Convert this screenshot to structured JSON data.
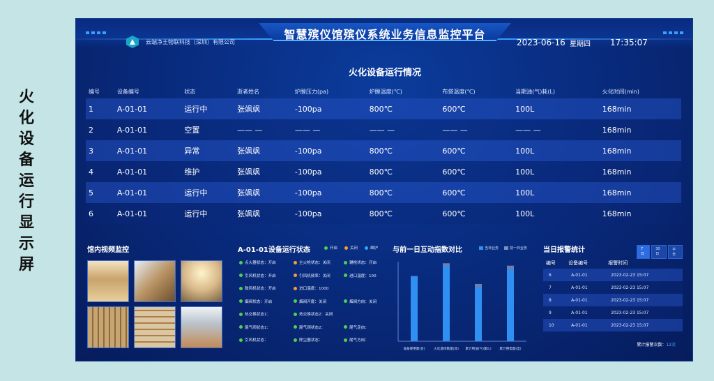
{
  "side_title": [
    "火",
    "化",
    "设",
    "备",
    "运",
    "行",
    "显",
    "示",
    "屏"
  ],
  "header": {
    "title": "智慧殡仪馆殡仪系统业务信息监控平台",
    "company": "云端净土物联科技（深圳）有限公司",
    "date": "2023-06-16",
    "weekday": "星期四",
    "time": "17:35:07"
  },
  "equipment": {
    "title": "火化设备运行情况",
    "columns": [
      "编号",
      "设备编号",
      "状态",
      "逝者姓名",
      "炉膛压力(pa)",
      "炉膛温度(℃)",
      "布袋温度(℃)",
      "当期油(气)耗(L)",
      "火化时间(min)"
    ],
    "rows": [
      [
        "1",
        "A-01-01",
        "运行中",
        "张飒飒",
        "-100pa",
        "800℃",
        "600℃",
        "100L",
        "168min"
      ],
      [
        "2",
        "A-01-01",
        "空置",
        "—— —",
        "—— —",
        "—— —",
        "—— —",
        "—— —",
        "168min"
      ],
      [
        "3",
        "A-01-01",
        "异常",
        "张飒飒",
        "-100pa",
        "800℃",
        "600℃",
        "100L",
        "168min"
      ],
      [
        "4",
        "A-01-01",
        "维护",
        "张飒飒",
        "-100pa",
        "800℃",
        "600℃",
        "100L",
        "168min"
      ],
      [
        "5",
        "A-01-01",
        "运行中",
        "张飒飒",
        "-100pa",
        "800℃",
        "600℃",
        "100L",
        "168min"
      ],
      [
        "6",
        "A-01-01",
        "运行中",
        "张飒飒",
        "-100pa",
        "800℃",
        "600℃",
        "100L",
        "168min"
      ]
    ]
  },
  "video": {
    "title": "馆内视频监控"
  },
  "status_panel": {
    "title": "A-01-01设备运行状态",
    "legend": [
      "开启",
      "关闭",
      "维护"
    ],
    "legend_colors": [
      "#4dd24d",
      "#ff9a2e",
      "#2aa8ff"
    ],
    "items": [
      {
        "text": "点火器状态：开启",
        "dot": "green"
      },
      {
        "text": "主火枪状态：关闭",
        "dot": "orange"
      },
      {
        "text": "辅枪状态：开启",
        "dot": "green"
      },
      {
        "text": "引风机状态：开启",
        "dot": "green"
      },
      {
        "text": "引风机频率：关闭",
        "dot": "orange"
      },
      {
        "text": "进口温度：100",
        "dot": "green"
      },
      {
        "text": "鼓风机状态：开启",
        "dot": "green"
      },
      {
        "text": "进口温度：1000",
        "dot": "orange"
      },
      {
        "text": "",
        "dot": "none"
      },
      {
        "text": "烟阀状态：开启",
        "dot": "green"
      },
      {
        "text": "烟阀开度：关闭",
        "dot": "green"
      },
      {
        "text": "烟阀方向：关闭",
        "dot": "green"
      },
      {
        "text": "热交换状态1：",
        "dot": "green"
      },
      {
        "text": "热交换状态2：关闭",
        "dot": "green"
      },
      {
        "text": "",
        "dot": "none"
      },
      {
        "text": "尾气阀状态1：",
        "dot": "green"
      },
      {
        "text": "尾气阀状态2：",
        "dot": "green"
      },
      {
        "text": "尾气走向：",
        "dot": "green"
      },
      {
        "text": "引风机状态：",
        "dot": "green"
      },
      {
        "text": "除尘器状态：",
        "dot": "green"
      },
      {
        "text": "尾气方向：",
        "dot": "green"
      }
    ]
  },
  "compare_chart": {
    "title": "与前一日互动指数对比",
    "legend": [
      "当日业务",
      "前一日业务"
    ],
    "colors": {
      "today": "#2f8ff2",
      "yesterday": "#7d8fb8"
    }
  },
  "chart_data": {
    "type": "bar",
    "categories": [
      "设备使用量(台)",
      "火化遗体数量(具)",
      "累计用油(气)量(L)",
      "累计用电量(度)"
    ],
    "series": [
      {
        "name": "当日业务",
        "values": [
          82,
          94,
          68,
          90
        ]
      },
      {
        "name": "前一日业务",
        "values": [
          70,
          98,
          72,
          95
        ]
      }
    ],
    "ylim": [
      0,
      100
    ]
  },
  "alarm": {
    "title": "当日报警统计",
    "tabs": [
      "7日",
      "30日",
      "半年"
    ],
    "columns": [
      "编号",
      "设备编号",
      "报警时间"
    ],
    "rows": [
      [
        "6",
        "A-01-01",
        "2023-02-23  15:07"
      ],
      [
        "7",
        "A-01-01",
        "2023-02-23  15:07"
      ],
      [
        "8",
        "A-01-01",
        "2023-02-23  15:07"
      ],
      [
        "9",
        "A-01-01",
        "2023-02-23  15:07"
      ],
      [
        "10",
        "A-01-01",
        "2023-02-23  15:07"
      ]
    ],
    "total_label": "累计报警次数：",
    "total_value": "12次"
  }
}
